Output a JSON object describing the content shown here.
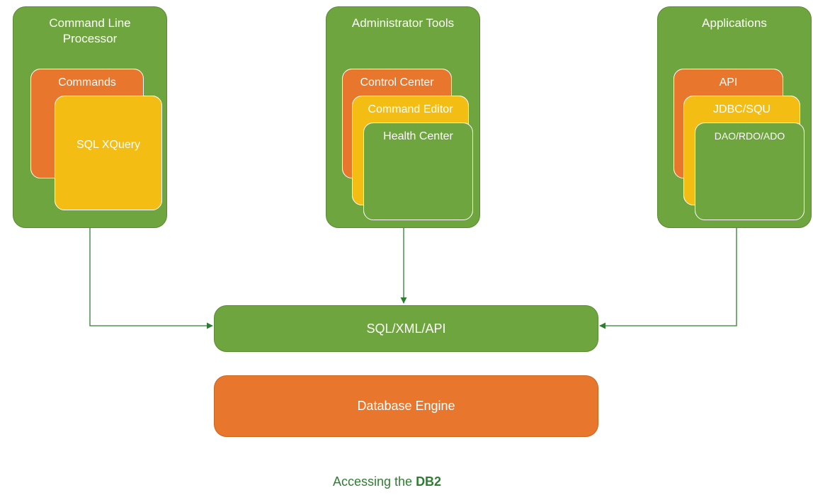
{
  "boxes": {
    "clp": {
      "title": "Command Line\nProcessor",
      "card_orange": "Commands",
      "card_yellow_center": "SQL XQuery"
    },
    "admin": {
      "title": "Administrator Tools",
      "card_orange": "Control Center",
      "card_yellow": "Command Editor",
      "card_green": "Health Center"
    },
    "apps": {
      "title": "Applications",
      "card_orange": "API",
      "card_yellow": "JDBC/SQU",
      "card_green": "DAO/RDO/ADO"
    },
    "mid": "SQL/XML/API",
    "engine": "Database Engine"
  },
  "caption_prefix": "Accessing the ",
  "caption_bold": "DB2",
  "colors": {
    "green": "#6FA53F",
    "orange": "#E8762D",
    "yellow": "#F3BD13",
    "line": "#2F7D32"
  }
}
